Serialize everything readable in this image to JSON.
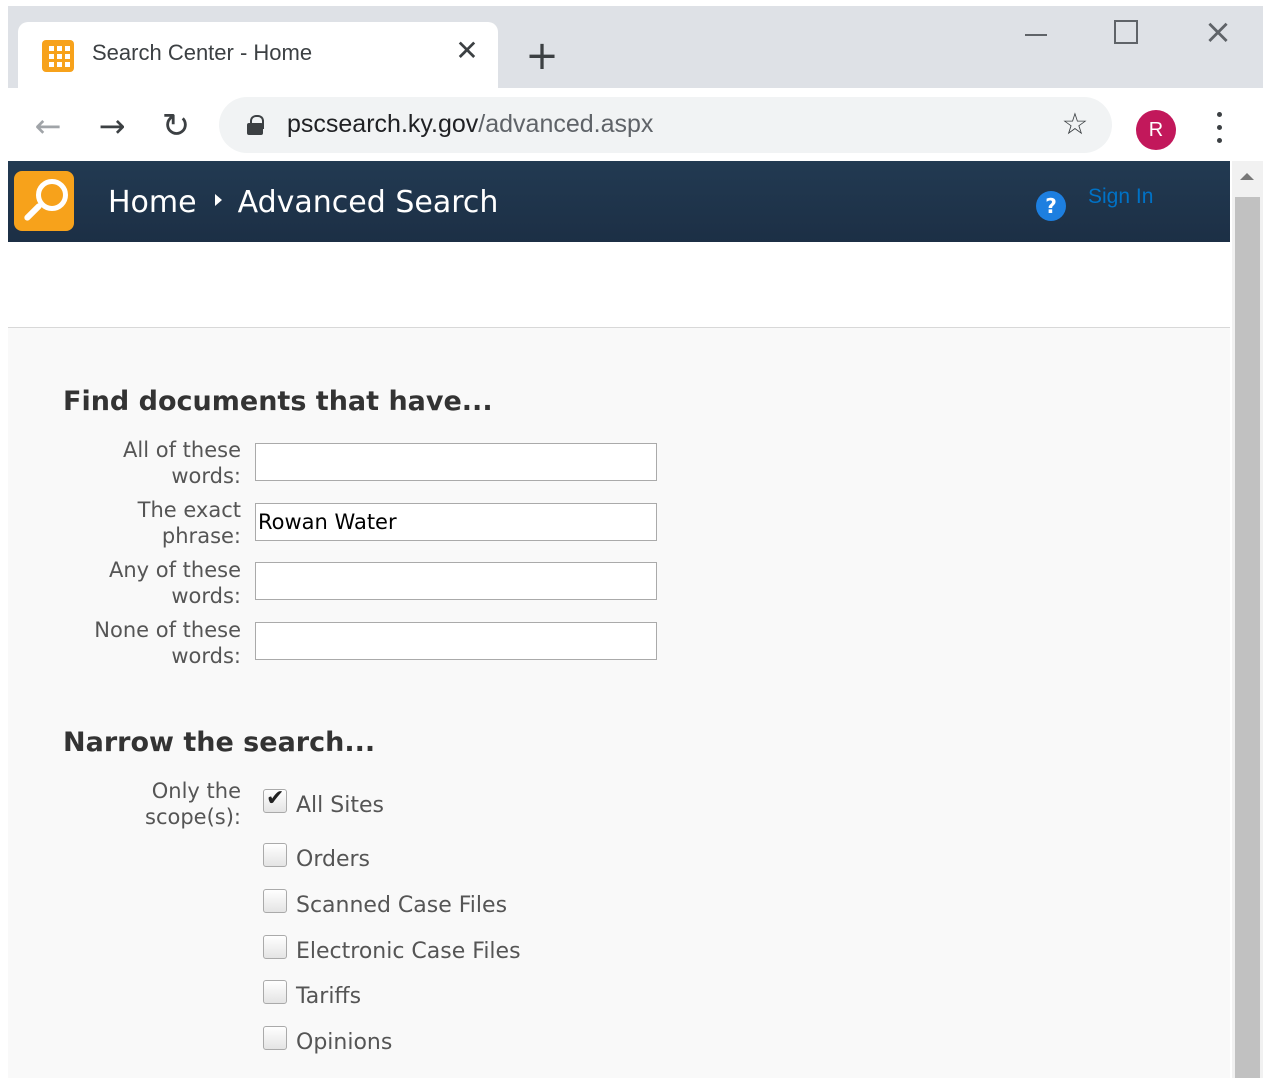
{
  "browser": {
    "tab_title": "Search Center - Home",
    "tab_close": "✕",
    "new_tab": "+",
    "url_host": "pscsearch.ky.gov",
    "url_path": "/advanced.aspx",
    "profile_initial": "R"
  },
  "header": {
    "breadcrumb_home": "Home",
    "breadcrumb_current": "Advanced Search",
    "help": "?",
    "sign_in": "Sign In"
  },
  "find": {
    "title": "Find documents that have...",
    "fields": [
      {
        "label_line1": "All of these",
        "label_line2": "words:",
        "value": ""
      },
      {
        "label_line1": "The exact",
        "label_line2": "phrase:",
        "value": "Rowan Water"
      },
      {
        "label_line1": "Any of these",
        "label_line2": "words:",
        "value": ""
      },
      {
        "label_line1": "None of these",
        "label_line2": "words:",
        "value": ""
      }
    ]
  },
  "narrow": {
    "title": "Narrow the search...",
    "scope_label_line1": "Only the",
    "scope_label_line2": "scope(s):",
    "scopes": [
      {
        "label": "All Sites",
        "checked": true
      },
      {
        "label": "Orders",
        "checked": false
      },
      {
        "label": "Scanned Case Files",
        "checked": false
      },
      {
        "label": "Electronic Case Files",
        "checked": false
      },
      {
        "label": "Tariffs",
        "checked": false
      },
      {
        "label": "Opinions",
        "checked": false
      }
    ]
  }
}
